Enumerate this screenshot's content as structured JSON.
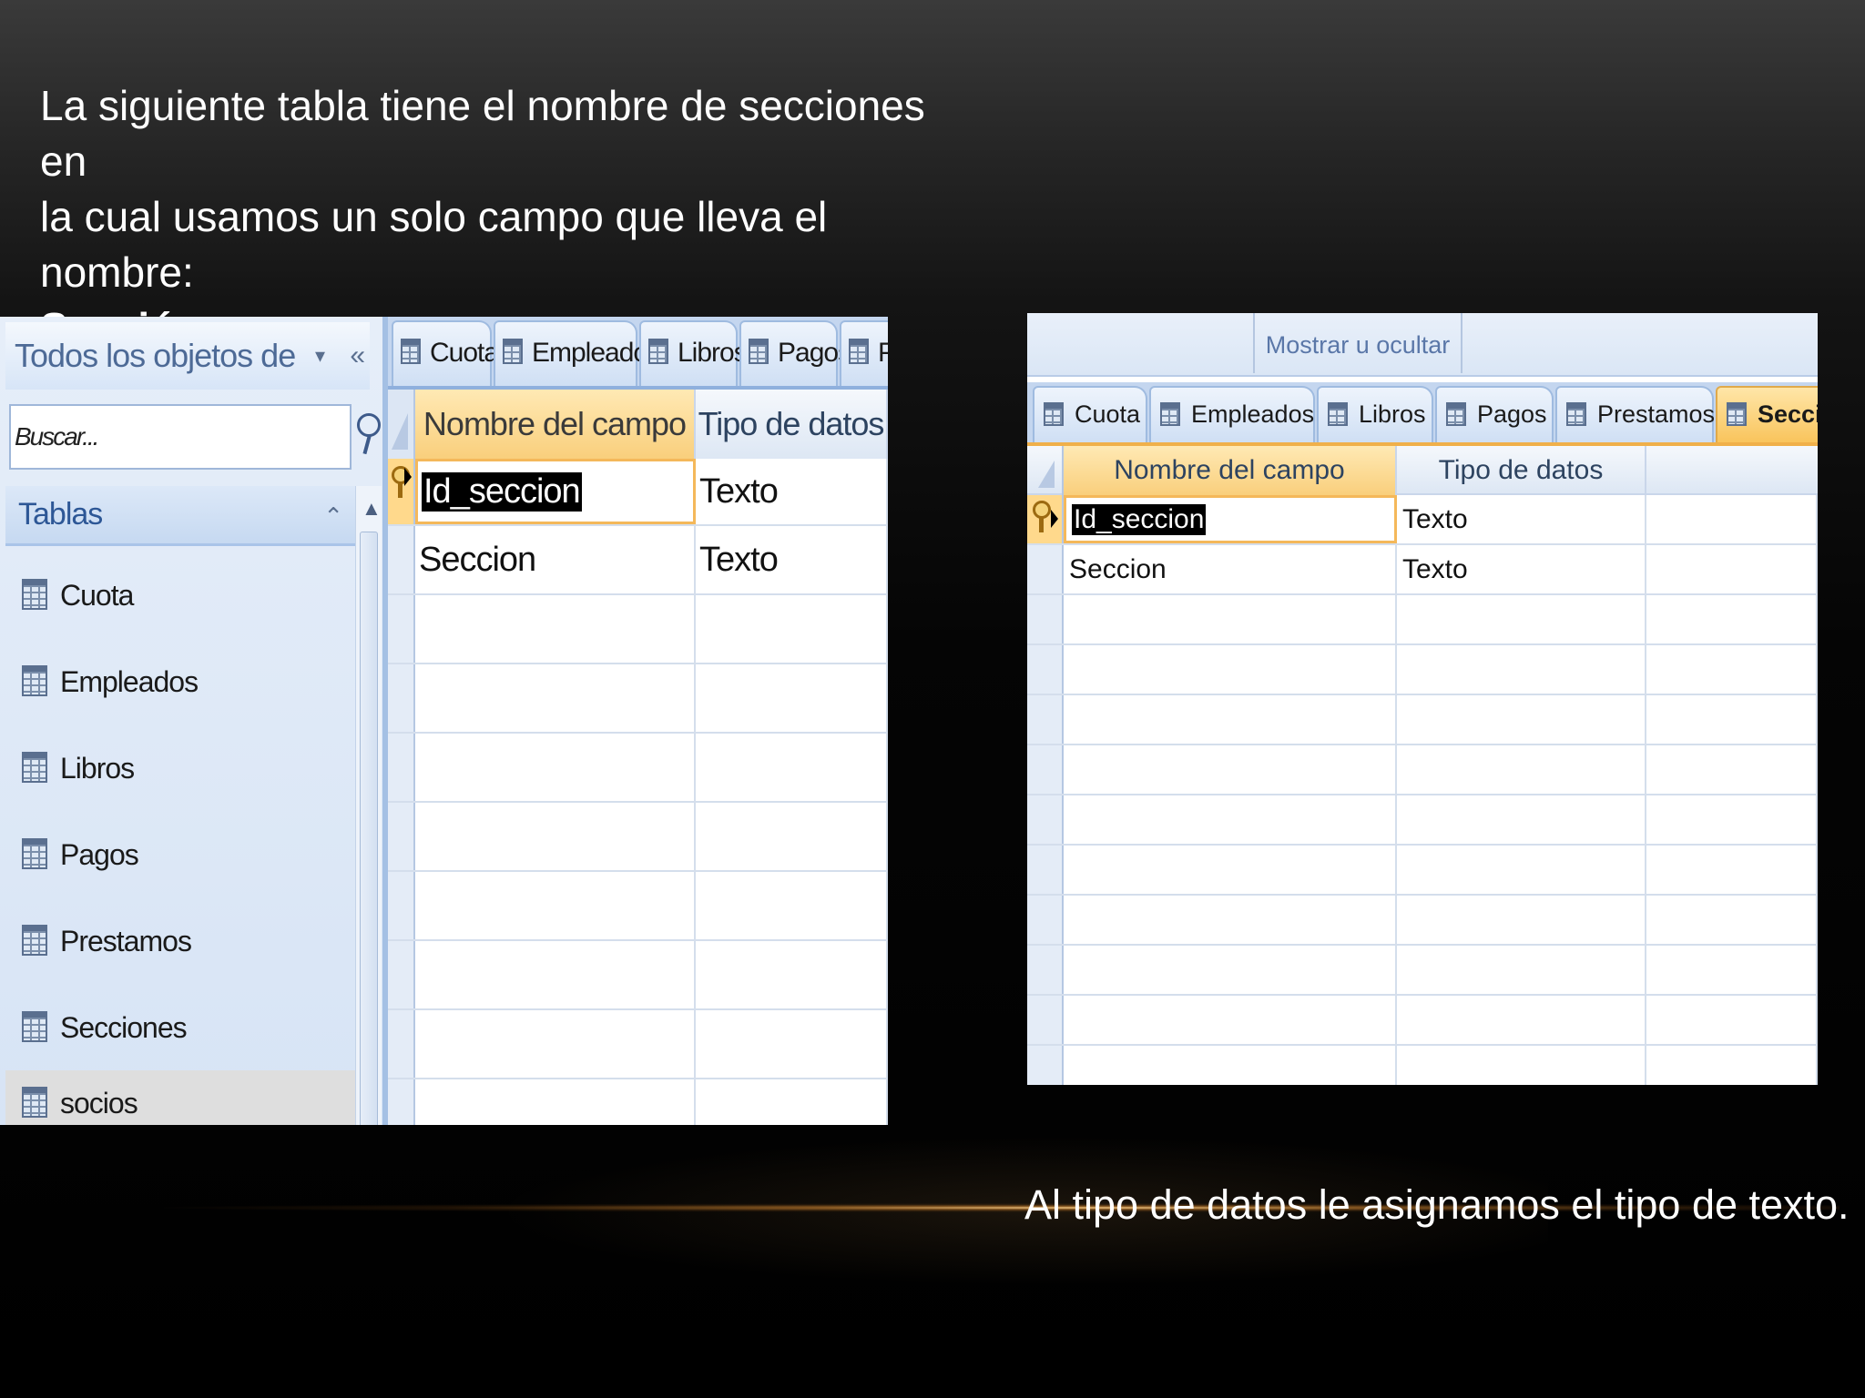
{
  "slide": {
    "intro_line1": "La siguiente tabla tiene el nombre de secciones en",
    "intro_line2": "la cual usamos un solo campo que lleva el nombre:",
    "intro_bold": "Sección",
    "caption": "Al tipo de datos le asignamos el tipo de texto."
  },
  "left_screenshot": {
    "nav_title": "Todos los objetos de Access",
    "nav_dropdown_glyph": "▾",
    "nav_collapse_glyph": "«",
    "search_placeholder": "Buscar...",
    "group_label": "Tablas",
    "group_collapse_glyph": "⌃",
    "scroll_up_glyph": "▲",
    "scroll_grip_glyph": "≡",
    "nav_items": [
      {
        "label": "Cuota"
      },
      {
        "label": "Empleados"
      },
      {
        "label": "Libros"
      },
      {
        "label": "Pagos"
      },
      {
        "label": "Prestamos"
      },
      {
        "label": "Secciones"
      },
      {
        "label": "socios"
      }
    ],
    "tabs": [
      {
        "label": "Cuota"
      },
      {
        "label": "Empleados"
      },
      {
        "label": "Libros"
      },
      {
        "label": "Pagos"
      },
      {
        "label": "Pr"
      }
    ],
    "columns": [
      "Nombre del campo",
      "Tipo de datos"
    ],
    "rows": [
      {
        "field": "Id_seccion",
        "type": "Texto"
      },
      {
        "field": "Seccion",
        "type": "Texto"
      }
    ]
  },
  "right_screenshot": {
    "ribbon_group_label": "Mostrar u ocultar",
    "tabs": [
      {
        "label": "Cuota"
      },
      {
        "label": "Empleados"
      },
      {
        "label": "Libros"
      },
      {
        "label": "Pagos"
      },
      {
        "label": "Prestamos"
      },
      {
        "label": "Seccio"
      }
    ],
    "columns": [
      "Nombre del campo",
      "Tipo de datos"
    ],
    "rows": [
      {
        "field": "Id_seccion",
        "type": "Texto"
      },
      {
        "field": "Seccion",
        "type": "Texto"
      }
    ]
  },
  "colors": {
    "access_blue": "#c4d6ef",
    "active_orange": "#f9c45c",
    "slide_text": "#ffffff"
  }
}
